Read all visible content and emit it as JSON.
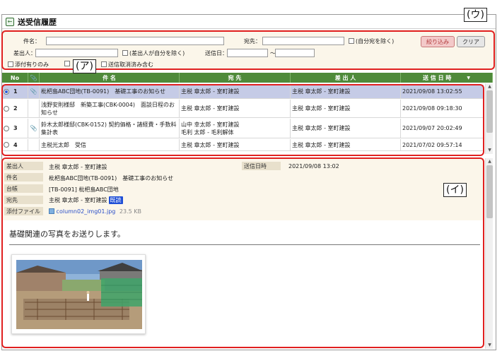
{
  "window": {
    "title": "送受信履歴"
  },
  "callouts": {
    "u": "(ウ)",
    "a": "(ア)",
    "i": "(イ)"
  },
  "search": {
    "subject_label": "件名：",
    "recipient_label": "宛先：",
    "self_recipient_check": "(自分宛を除く)",
    "sender_label": "差出人：",
    "self_sender_check": "(差出人が自分を除く)",
    "send_date_label": "送信日：",
    "date_sep": "～",
    "attach_only": "添付有りのみ",
    "include_cancelled": "送信取消済み含む",
    "filter_button": "絞り込み",
    "clear_button": "クリア"
  },
  "table": {
    "headers": [
      "No",
      "",
      "件 名",
      "宛 先",
      "差 出 人",
      "送 信 日 時"
    ],
    "rows": [
      {
        "no": "1",
        "selected": true,
        "attach": true,
        "subject": "枇杷島ABC団地(TB-0091)　基礎工事のお知らせ",
        "recipient": "主税 章太郎 - 室町建設",
        "sender": "主税 章太郎 - 室町建設",
        "datetime": "2021/09/08 13:02:55"
      },
      {
        "no": "2",
        "selected": false,
        "attach": false,
        "subject": "浅野安則様邸　新築工事(CBK-0004)　面談日程のお知らせ",
        "recipient": "主税 章太郎 - 室町建設",
        "sender": "主税 章太郎 - 室町建設",
        "datetime": "2021/09/08 09:18:30"
      },
      {
        "no": "3",
        "selected": false,
        "attach": true,
        "subject": "鈴木太郎様邸(CBK-0152) 契約価格・諸経費・手数料集計表",
        "recipient": "山中 幸太郎 - 室町建設\n毛利 太郎 - 毛利解体",
        "sender": "主税 章太郎 - 室町建設",
        "datetime": "2021/09/07 20:02:49"
      },
      {
        "no": "4",
        "selected": false,
        "attach": false,
        "subject": "主税光太郎　受信",
        "recipient": "主税 章太郎 - 室町建設",
        "sender": "主税 章太郎 - 室町建設",
        "datetime": "2021/07/02 09:57:14"
      }
    ]
  },
  "detail": {
    "sender_label": "差出人",
    "sender_value": "主税 章太郎 - 室町建設",
    "datetime_label": "送信日時",
    "datetime_value": "2021/09/08 13:02",
    "subject_label": "件名",
    "subject_value": "枇杷島ABC団地(TB-0091)　基礎工事のお知らせ",
    "ledger_label": "台帳",
    "ledger_value": "[TB-0091] 枇杷島ABC団地",
    "recipient_label": "宛先",
    "recipient_value": "主税 章太郎 - 室町建設",
    "read_badge": "既読",
    "attachment_label": "添付ファイル",
    "attachment_name": "column02_img01.jpg",
    "attachment_size": "23.5 KB",
    "body": "基礎関連の写真をお送りします。"
  }
}
